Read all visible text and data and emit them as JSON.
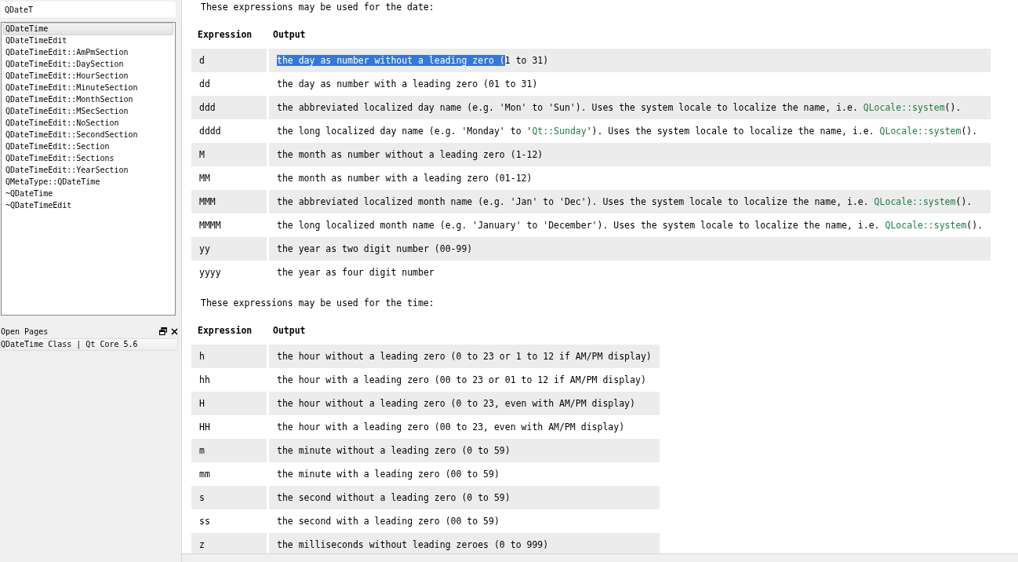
{
  "sidebar": {
    "search": {
      "value": "QDateT"
    },
    "index_items": [
      {
        "label": "QDateTime",
        "selected": true
      },
      {
        "label": "QDateTimeEdit",
        "selected": false
      },
      {
        "label": "QDateTimeEdit::AmPmSection",
        "selected": false
      },
      {
        "label": "QDateTimeEdit::DaySection",
        "selected": false
      },
      {
        "label": "QDateTimeEdit::HourSection",
        "selected": false
      },
      {
        "label": "QDateTimeEdit::MinuteSection",
        "selected": false
      },
      {
        "label": "QDateTimeEdit::MonthSection",
        "selected": false
      },
      {
        "label": "QDateTimeEdit::MSecSection",
        "selected": false
      },
      {
        "label": "QDateTimeEdit::NoSection",
        "selected": false
      },
      {
        "label": "QDateTimeEdit::SecondSection",
        "selected": false
      },
      {
        "label": "QDateTimeEdit::Section",
        "selected": false
      },
      {
        "label": "QDateTimeEdit::Sections",
        "selected": false
      },
      {
        "label": "QDateTimeEdit::YearSection",
        "selected": false
      },
      {
        "label": "QMetaType::QDateTime",
        "selected": false
      },
      {
        "label": "~QDateTime",
        "selected": false
      },
      {
        "label": "~QDateTimeEdit",
        "selected": false
      }
    ],
    "open_pages": {
      "title": "Open Pages",
      "items": [
        {
          "label": "QDateTime Class | Qt Core 5.6",
          "selected": true
        }
      ]
    }
  },
  "content": {
    "sections": [
      {
        "intro": "These expressions may be used for the date:",
        "columns": [
          "Expression",
          "Output"
        ],
        "rows": [
          {
            "expression": "d",
            "output": [
              {
                "kind": "selected",
                "text": "the day as number without a leading zero ("
              },
              {
                "kind": "plain",
                "text": "1 to 31)"
              }
            ]
          },
          {
            "expression": "dd",
            "output": [
              {
                "kind": "plain",
                "text": "the day as number with a leading zero (01 to 31)"
              }
            ]
          },
          {
            "expression": "ddd",
            "output": [
              {
                "kind": "plain",
                "text": "the abbreviated localized day name (e.g. 'Mon' to 'Sun'). Uses the system locale to localize the name, i.e. "
              },
              {
                "kind": "link",
                "text": "QLocale::system"
              },
              {
                "kind": "plain",
                "text": "()."
              }
            ]
          },
          {
            "expression": "dddd",
            "output": [
              {
                "kind": "plain",
                "text": "the long localized day name (e.g. 'Monday' to '"
              },
              {
                "kind": "link",
                "text": "Qt::Sunday"
              },
              {
                "kind": "plain",
                "text": "'). Uses the system locale to localize the name, i.e. "
              },
              {
                "kind": "link",
                "text": "QLocale::system"
              },
              {
                "kind": "plain",
                "text": "()."
              }
            ]
          },
          {
            "expression": "M",
            "output": [
              {
                "kind": "plain",
                "text": "the month as number without a leading zero (1-12)"
              }
            ]
          },
          {
            "expression": "MM",
            "output": [
              {
                "kind": "plain",
                "text": "the month as number with a leading zero (01-12)"
              }
            ]
          },
          {
            "expression": "MMM",
            "output": [
              {
                "kind": "plain",
                "text": "the abbreviated localized month name (e.g. 'Jan' to 'Dec'). Uses the system locale to localize the name, i.e. "
              },
              {
                "kind": "link",
                "text": "QLocale::system"
              },
              {
                "kind": "plain",
                "text": "()."
              }
            ]
          },
          {
            "expression": "MMMM",
            "output": [
              {
                "kind": "plain",
                "text": "the long localized month name (e.g. 'January' to 'December'). Uses the system locale to localize the name, i.e. "
              },
              {
                "kind": "link",
                "text": "QLocale::system"
              },
              {
                "kind": "plain",
                "text": "()."
              }
            ]
          },
          {
            "expression": "yy",
            "output": [
              {
                "kind": "plain",
                "text": "the year as two digit number (00-99)"
              }
            ]
          },
          {
            "expression": "yyyy",
            "output": [
              {
                "kind": "plain",
                "text": "the year as four digit number"
              }
            ]
          }
        ]
      },
      {
        "intro": "These expressions may be used for the time:",
        "columns": [
          "Expression",
          "Output"
        ],
        "rows": [
          {
            "expression": "h",
            "output": [
              {
                "kind": "plain",
                "text": "the hour without a leading zero (0 to 23 or 1 to 12 if AM/PM display)"
              }
            ]
          },
          {
            "expression": "hh",
            "output": [
              {
                "kind": "plain",
                "text": "the hour with a leading zero (00 to 23 or 01 to 12 if AM/PM display)"
              }
            ]
          },
          {
            "expression": "H",
            "output": [
              {
                "kind": "plain",
                "text": "the hour without a leading zero (0 to 23, even with AM/PM display)"
              }
            ]
          },
          {
            "expression": "HH",
            "output": [
              {
                "kind": "plain",
                "text": "the hour with a leading zero (00 to 23, even with AM/PM display)"
              }
            ]
          },
          {
            "expression": "m",
            "output": [
              {
                "kind": "plain",
                "text": "the minute without a leading zero (0 to 59)"
              }
            ]
          },
          {
            "expression": "mm",
            "output": [
              {
                "kind": "plain",
                "text": "the minute with a leading zero (00 to 59)"
              }
            ]
          },
          {
            "expression": "s",
            "output": [
              {
                "kind": "plain",
                "text": "the second without a leading zero (0 to 59)"
              }
            ]
          },
          {
            "expression": "ss",
            "output": [
              {
                "kind": "plain",
                "text": "the second with a leading zero (00 to 59)"
              }
            ]
          },
          {
            "expression": "z",
            "output": [
              {
                "kind": "plain",
                "text": "the milliseconds without leading zeroes (0 to 999)"
              }
            ]
          }
        ]
      }
    ]
  }
}
